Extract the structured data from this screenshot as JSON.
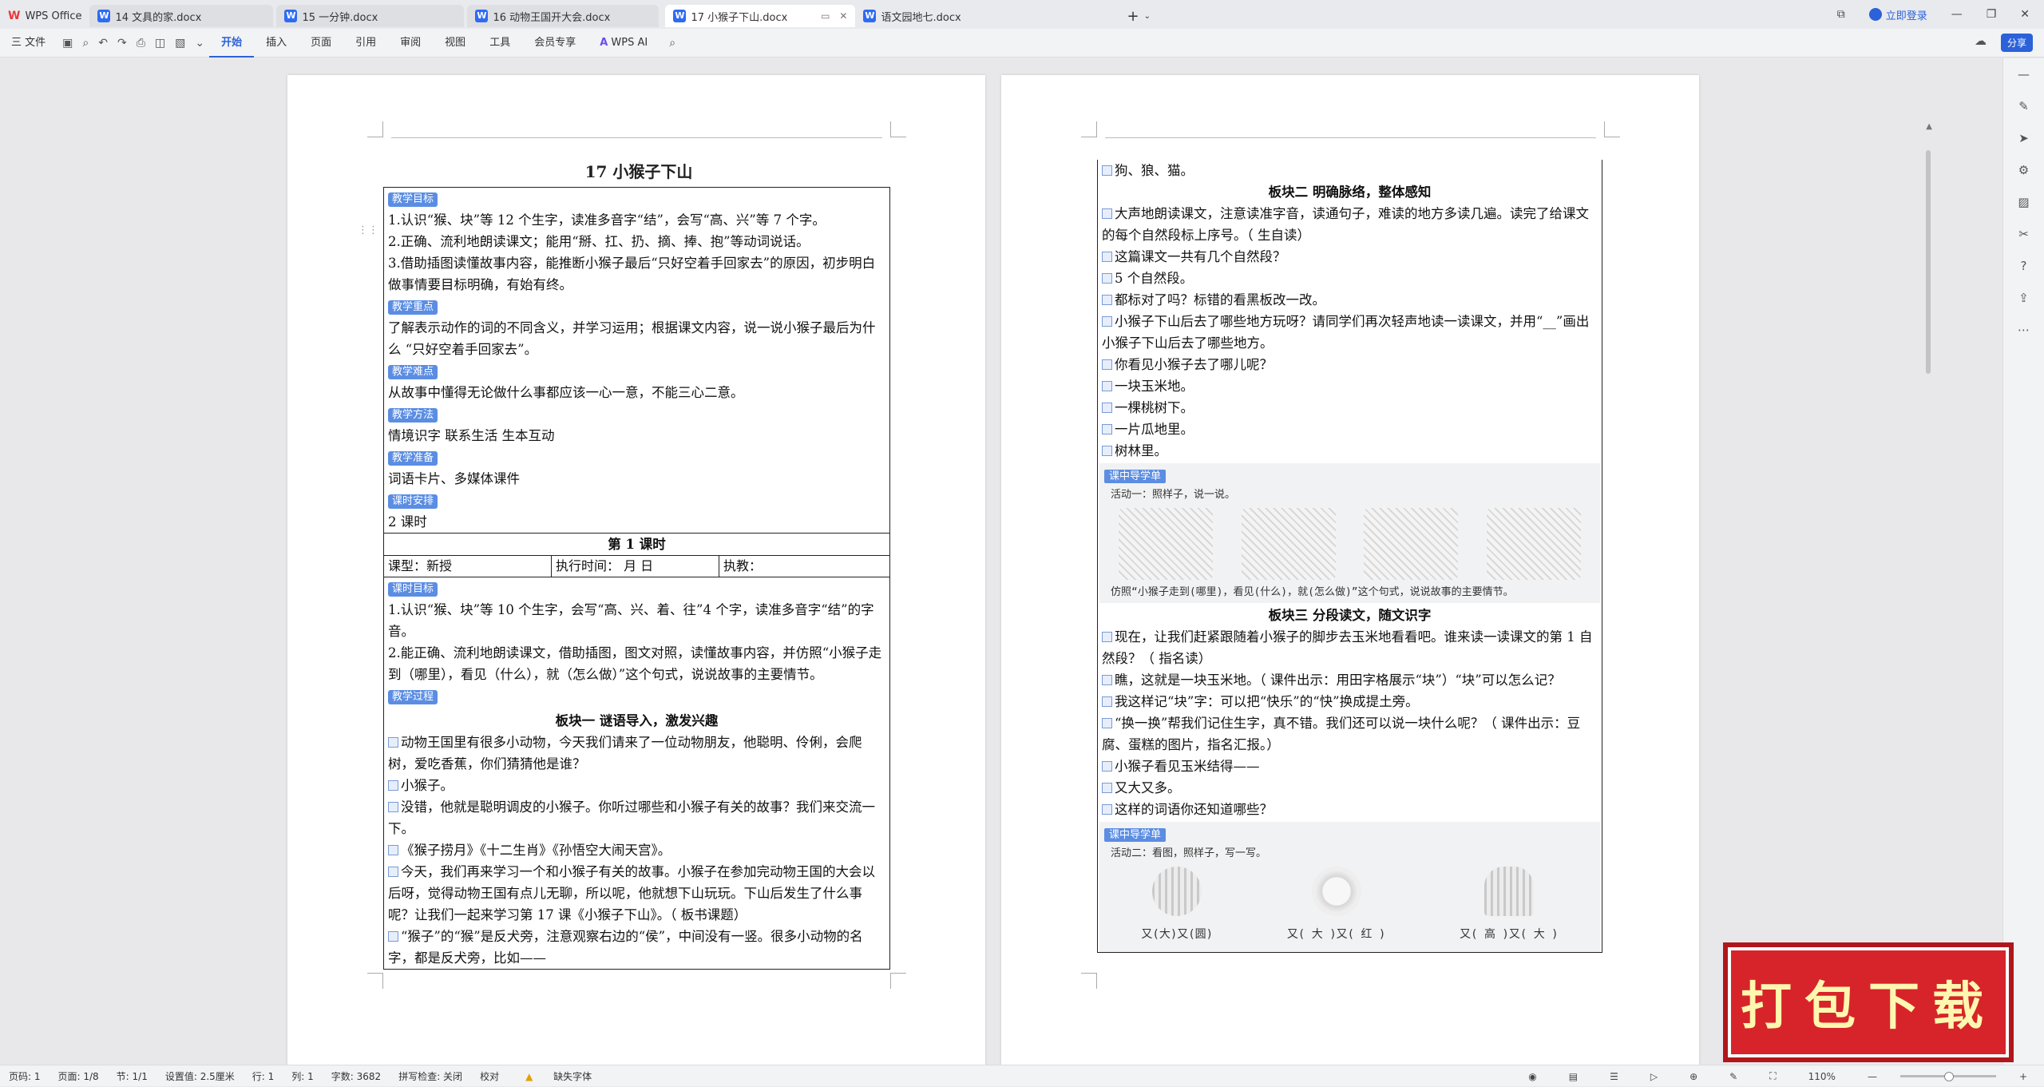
{
  "tabs": [
    {
      "label": "WPS Office",
      "type": "home"
    },
    {
      "label": "14 文具的家.docx",
      "type": "doc"
    },
    {
      "label": "15 一分钟.docx",
      "type": "doc"
    },
    {
      "label": "16 动物王国开大会.docx",
      "type": "doc"
    },
    {
      "label": "17 小猴子下山.docx",
      "type": "doc",
      "active": true
    },
    {
      "label": "语文园地七.docx",
      "type": "doc"
    }
  ],
  "window": {
    "login": "立即登录",
    "share": "分享"
  },
  "menu": {
    "file": "三 文件",
    "items": [
      "开始",
      "插入",
      "页面",
      "引用",
      "审阅",
      "视图",
      "工具",
      "会员专享"
    ],
    "ai": "WPS AI"
  },
  "doc_left": {
    "title": "17  小猴子下山",
    "s1_badge": "教学目标",
    "goal1": "1.认识“猴、块”等 12 个生字，读准多音字“结”，会写“高、兴”等 7 个字。",
    "goal2": "2.正确、流利地朗读课文；能用“掰、扛、扔、摘、捧、抱”等动词说话。",
    "goal3": "3.借助插图读懂故事内容，能推断小猴子最后“只好空着手回家去”的原因，初步明白做事情要目标明确，有始有终。",
    "s2_badge": "教学重点",
    "key": "了解表示动作的词的不同含义，并学习运用；根据课文内容，说一说小猴子最后为什么 “只好空着手回家去”。",
    "s3_badge": "教学难点",
    "diff": "从故事中懂得无论做什么事都应该一心一意，不能三心二意。",
    "s4_badge": "教学方法",
    "method": "情境识字  联系生活  生本互动",
    "s5_badge": "教学准备",
    "prep": "词语卡片、多媒体课件",
    "s6_badge": "课时安排",
    "hours": "2 课时",
    "lesson": "第 1 课时",
    "type": "课型：新授",
    "time": "执行时间：        月        日",
    "teacher": "执教：",
    "s7_badge": "课时目标",
    "lg1": "1.认识“猴、块”等 10 个生字，会写“高、兴、着、往”4 个字，读准多音字“结”的字音。",
    "lg2": "2.能正确、流利地朗读课文，借助插图，图文对照，读懂故事内容，并仿照“小猴子走到（哪里），看见（什么），就（怎么做）”这个句式，说说故事的主要情节。",
    "s8_badge": "教学过程",
    "block1": "板块一  谜语导入，激发兴趣",
    "p1": "动物王国里有很多小动物，今天我们请来了一位动物朋友，他聪明、伶俐，会爬树，爱吃香蕉，你们猜猜他是谁？",
    "p2": "小猴子。",
    "p3": "没错，他就是聪明调皮的小猴子。你听过哪些和小猴子有关的故事？我们来交流一下。",
    "p4": "《猴子捞月》《十二生肖》《孙悟空大闹天宫》。",
    "p5": "今天，我们再来学习一个和小猴子有关的故事。小猴子在参加完动物王国的大会以后呀，觉得动物王国有点儿无聊，所以呢，他就想下山玩玩。下山后发生了什么事呢？让我们一起来学习第 17 课《小猴子下山》。（ 板书课题）",
    "p6": "“猴子”的“猴”是反犬旁，注意观察右边的“侯”，中间没有一竖。很多小动物的名字，都是反犬旁，比如——"
  },
  "doc_right": {
    "r0": "狗、狼、猫。",
    "block2": "板块二  明确脉络，整体感知",
    "r1": "大声地朗读课文，注意读准字音，读通句子，难读的地方多读几遍。读完了给课文的每个自然段标上序号。（ 生自读）",
    "r2": "这篇课文一共有几个自然段？",
    "r3": "5 个自然段。",
    "r4": "都标对了吗？标错的看黑板改一改。",
    "r5": "小猴子下山后去了哪些地方玩呀？请同学们再次轻声地读一读课文，并用“__”画出小猴子下山后去了哪些地方。",
    "r6": "你看见小猴子去了哪儿呢？",
    "r7": "一块玉米地。",
    "r8": "一棵桃树下。",
    "r9": "一片瓜地里。",
    "r10": "树林里。",
    "panel1_badge": "课中导学单",
    "panel1_act": "活动一：照样子，说一说。",
    "panel1_note": "仿照“小猴子走到(哪里)，看见(什么)，就(怎么做)”这个句式，说说故事的主要情节。",
    "block3": "板块三  分段读文，随文识字",
    "r11": "现在，让我们赶紧跟随着小猴子的脚步去玉米地看看吧。谁来读一读课文的第 1 自然段？（ 指名读）",
    "r12": "瞧，这就是一块玉米地。（ 课件出示：用田字格展示“块”）“块”可以怎么记？",
    "r13": "我这样记“块”字：可以把“快乐”的“快”换成提土旁。",
    "r14": "“换一换”帮我们记住生字，真不错。我们还可以说一块什么呢？（ 课件出示：豆腐、蛋糕的图片，指名汇报。）",
    "r15": "小猴子看见玉米结得——",
    "r16": "又大又多。",
    "r17": "这样的词语你还知道哪些？",
    "panel2_badge": "课中导学单",
    "panel2_act": "活动二：看图，照样子，写一写。",
    "fruit1": "又(大)又(圆)",
    "fruit2": "又( 大 )又( 红 )",
    "fruit3": "又( 高 )又( 大 )"
  },
  "status": {
    "page": "页码: 1",
    "pages": "页面: 1/8",
    "section": "节: 1/1",
    "setting": "设置值: 2.5厘米",
    "row": "行: 1",
    "col": "列: 1",
    "words": "字数: 3682",
    "spell": "拼写检查: 关闭",
    "proof": "校对",
    "font": "缺失字体",
    "zoom": "110%"
  },
  "promo": {
    "text": "打包下载"
  }
}
